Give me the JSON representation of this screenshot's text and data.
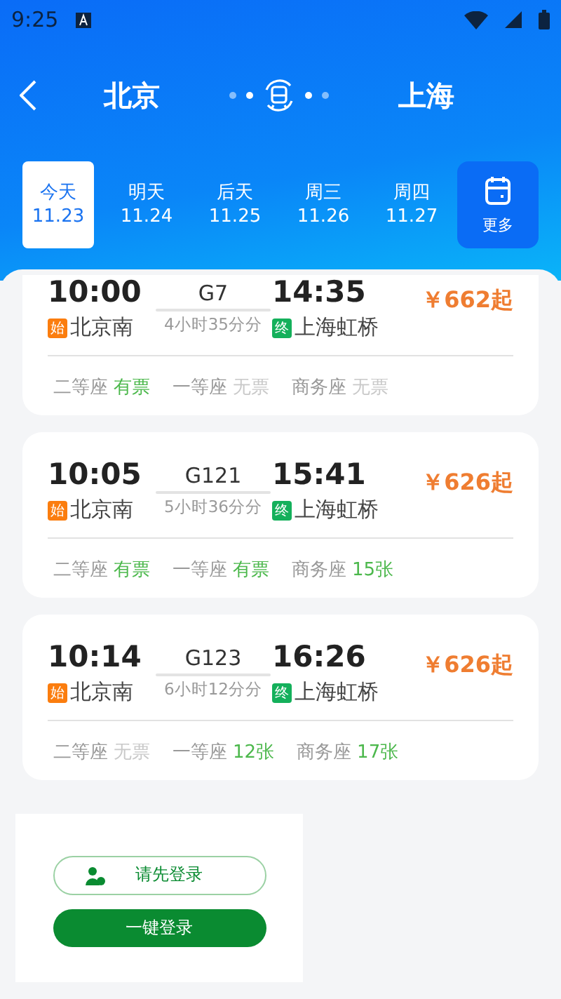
{
  "status_bar": {
    "time": "9:25"
  },
  "route": {
    "from": "北京",
    "to": "上海"
  },
  "dates": [
    {
      "day": "今天",
      "date": "11.23",
      "selected": true
    },
    {
      "day": "明天",
      "date": "11.24",
      "selected": false
    },
    {
      "day": "后天",
      "date": "11.25",
      "selected": false
    },
    {
      "day": "周三",
      "date": "11.26",
      "selected": false
    },
    {
      "day": "周四",
      "date": "11.27",
      "selected": false
    }
  ],
  "more_label": "更多",
  "trains": [
    {
      "depart": "10:00",
      "number": "G7",
      "arrive": "14:35",
      "from_badge": "始",
      "from": "北京南",
      "duration": "4小时35分分",
      "to_badge": "终",
      "to": "上海虹桥",
      "price": "￥662起",
      "seats": [
        {
          "name": "二等座",
          "status": "有票",
          "available": true
        },
        {
          "name": "一等座",
          "status": "无票",
          "available": false
        },
        {
          "name": "商务座",
          "status": "无票",
          "available": false
        }
      ]
    },
    {
      "depart": "10:05",
      "number": "G121",
      "arrive": "15:41",
      "from_badge": "始",
      "from": "北京南",
      "duration": "5小时36分分",
      "to_badge": "终",
      "to": "上海虹桥",
      "price": "￥626起",
      "seats": [
        {
          "name": "二等座",
          "status": "有票",
          "available": true
        },
        {
          "name": "一等座",
          "status": "有票",
          "available": true
        },
        {
          "name": "商务座",
          "status": "15张",
          "available": true
        }
      ]
    },
    {
      "depart": "10:14",
      "number": "G123",
      "arrive": "16:26",
      "from_badge": "始",
      "from": "北京南",
      "duration": "6小时12分分",
      "to_badge": "终",
      "to": "上海虹桥",
      "price": "￥626起",
      "seats": [
        {
          "name": "二等座",
          "status": "无票",
          "available": false
        },
        {
          "name": "一等座",
          "status": "12张",
          "available": true
        },
        {
          "name": "商务座",
          "status": "17张",
          "available": true
        }
      ]
    }
  ],
  "login": {
    "prompt": "请先登录",
    "button": "一键登录"
  }
}
